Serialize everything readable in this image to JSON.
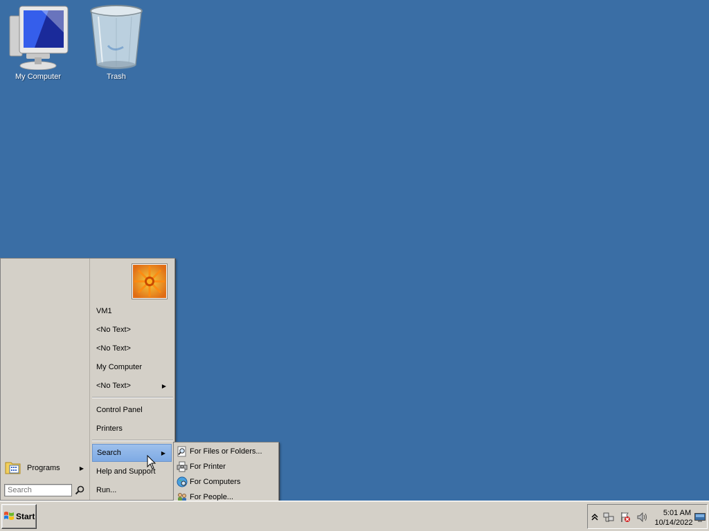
{
  "desktop": {
    "background": "#3a6ea5",
    "icons": [
      {
        "label": "My Computer",
        "icon": "computer-icon"
      },
      {
        "label": "Trash",
        "icon": "trash-icon"
      }
    ]
  },
  "start_menu": {
    "avatar": "flower-avatar",
    "items": [
      {
        "label": "VM1"
      },
      {
        "label": "<No Text>"
      },
      {
        "label": "<No Text>"
      },
      {
        "label": "My Computer"
      },
      {
        "label": "<No Text>",
        "has_submenu": true
      },
      {
        "label": "Control Panel"
      },
      {
        "label": "Printers"
      },
      {
        "label": "Search",
        "has_submenu": true,
        "highlighted": true
      },
      {
        "label": "Help and Support"
      },
      {
        "label": "Run..."
      }
    ],
    "programs_label": "Programs",
    "search_placeholder": "Search"
  },
  "search_submenu": {
    "items": [
      {
        "label": "For Files or Folders...",
        "icon": "magnifier-document-icon"
      },
      {
        "label": "For Printer",
        "icon": "printer-icon"
      },
      {
        "label": "For Computers",
        "icon": "globe-icon"
      },
      {
        "label": "For People...",
        "icon": "people-icon"
      }
    ]
  },
  "taskbar": {
    "start_label": "Start",
    "clock_time": "5:01 AM",
    "clock_date": "10/14/2022",
    "tray_icons": [
      "chevron-up-icon",
      "network-icon",
      "flag-error-icon",
      "volume-icon",
      "desktop-icon"
    ]
  },
  "colors": {
    "accent_highlight": "#7eaae4",
    "menu_background": "#d4d0c8"
  }
}
